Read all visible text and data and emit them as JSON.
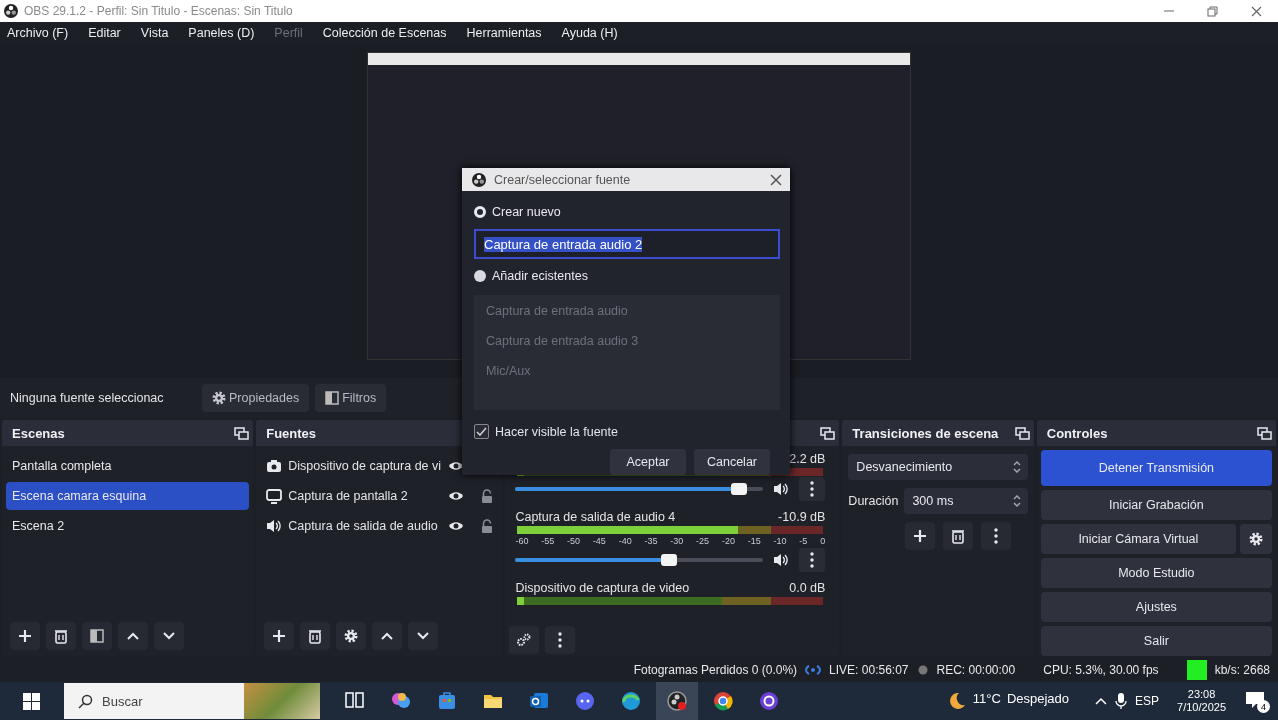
{
  "window": {
    "title": "OBS 29.1.2 - Perfil: Sin Titulo - Escenas: Sin Titulo"
  },
  "menu": [
    {
      "label": "Archivo (F)",
      "disabled": false
    },
    {
      "label": "Editar",
      "disabled": false
    },
    {
      "label": "Vista",
      "disabled": false
    },
    {
      "label": "Paneles (D)",
      "disabled": false
    },
    {
      "label": "Perfil",
      "disabled": true
    },
    {
      "label": "Colección de Escenas",
      "disabled": false
    },
    {
      "label": "Herramientas",
      "disabled": false
    },
    {
      "label": "Ayuda (H)",
      "disabled": false
    }
  ],
  "source_bar": {
    "status": "Ninguna fuente seleccionac",
    "buttons": [
      {
        "kind": "properties",
        "label": "Propiedades"
      },
      {
        "kind": "filters",
        "label": "Filtros"
      }
    ]
  },
  "scenes": {
    "title": "Escenas",
    "items": [
      {
        "label": "Pantalla completa",
        "selected": false
      },
      {
        "label": "Escena camara esquina",
        "selected": true
      },
      {
        "label": "Escena 2",
        "selected": false
      }
    ]
  },
  "sources": {
    "title": "Fuentes",
    "items": [
      {
        "kind": "camera",
        "label": "Dispositivo de captura de vi",
        "visible": true
      },
      {
        "kind": "display",
        "label": "Captura de pantalla 2",
        "visible": true
      },
      {
        "kind": "audio",
        "label": "Captura de salida de audio",
        "visible": true
      }
    ]
  },
  "mixer": {
    "channels": [
      {
        "reading": "2.2 dB",
        "meter": {
          "level": 0.02
        },
        "fader": {
          "level": 0.9
        }
      },
      {
        "name": "Captura de salida de audio 4",
        "reading": "-10.9 dB",
        "scale": [
          "-60",
          "-55",
          "-50",
          "-45",
          "-40",
          "-35",
          "-30",
          "-25",
          "-20",
          "-15",
          "-10",
          "-5",
          "0"
        ],
        "meter": {
          "level": 0.72
        },
        "fader": {
          "level": 0.62
        }
      },
      {
        "name": "Dispositivo de captura de video",
        "reading": "0.0 dB",
        "meter": {
          "level": 0.02
        }
      }
    ]
  },
  "transitions": {
    "title": "Transiciones de escena",
    "selected": "Desvanecimiento",
    "duration_label": "Duración",
    "duration": "300 ms"
  },
  "controls": {
    "title": "Controles",
    "buttons": [
      {
        "label": "Detener Transmisión",
        "active": true,
        "has_settings": false
      },
      {
        "label": "Iniciar Grabación",
        "active": false,
        "has_settings": false
      },
      {
        "label": "Iniciar Cámara Virtual",
        "active": false,
        "has_settings": true
      },
      {
        "label": "Modo Estudio",
        "active": false,
        "has_settings": false
      },
      {
        "label": "Ajustes",
        "active": false,
        "has_settings": false
      },
      {
        "label": "Salir",
        "active": false,
        "has_settings": false
      }
    ]
  },
  "status_bar": {
    "dropped": "Fotogramas Perdidos 0 (0.0%)",
    "live": "LIVE: 00:56:07",
    "rec": "REC: 00:00:00",
    "cpu": "CPU: 5.3%, 30.00 fps",
    "bitrate": "kb/s: 2668"
  },
  "dialog": {
    "title": "Crear/seleccionar fuente",
    "options": [
      {
        "label": "Crear nuevo",
        "selected": true
      },
      {
        "label": "Añadir ecistentes",
        "selected": false
      }
    ],
    "name_value": "Captura de entrada audio 2",
    "existing": [
      {
        "label": "Captura de entrada audio",
        "disabled": true
      },
      {
        "label": "Captura de entrada audio 3",
        "disabled": true
      },
      {
        "label": "Mic/Aux",
        "disabled": true
      }
    ],
    "visible_checkbox": {
      "label": "Hacer visible la fuente",
      "checked": true
    },
    "buttons": [
      "Aceptar",
      "Cancelar"
    ]
  },
  "taskbar": {
    "search": {
      "placeholder": "Buscar"
    },
    "apps": [
      {
        "selected": false
      },
      {
        "selected": false
      },
      {
        "selected": false
      },
      {
        "selected": false
      },
      {
        "selected": false
      },
      {
        "selected": false
      },
      {
        "selected": false
      },
      {
        "selected": true
      },
      {
        "selected": false
      },
      {
        "selected": false
      }
    ],
    "weather": {
      "temp": "11°C",
      "text": "Despejado"
    },
    "language": "ESP",
    "time": "23:08",
    "date": "7/10/2025",
    "notifications": "4"
  }
}
